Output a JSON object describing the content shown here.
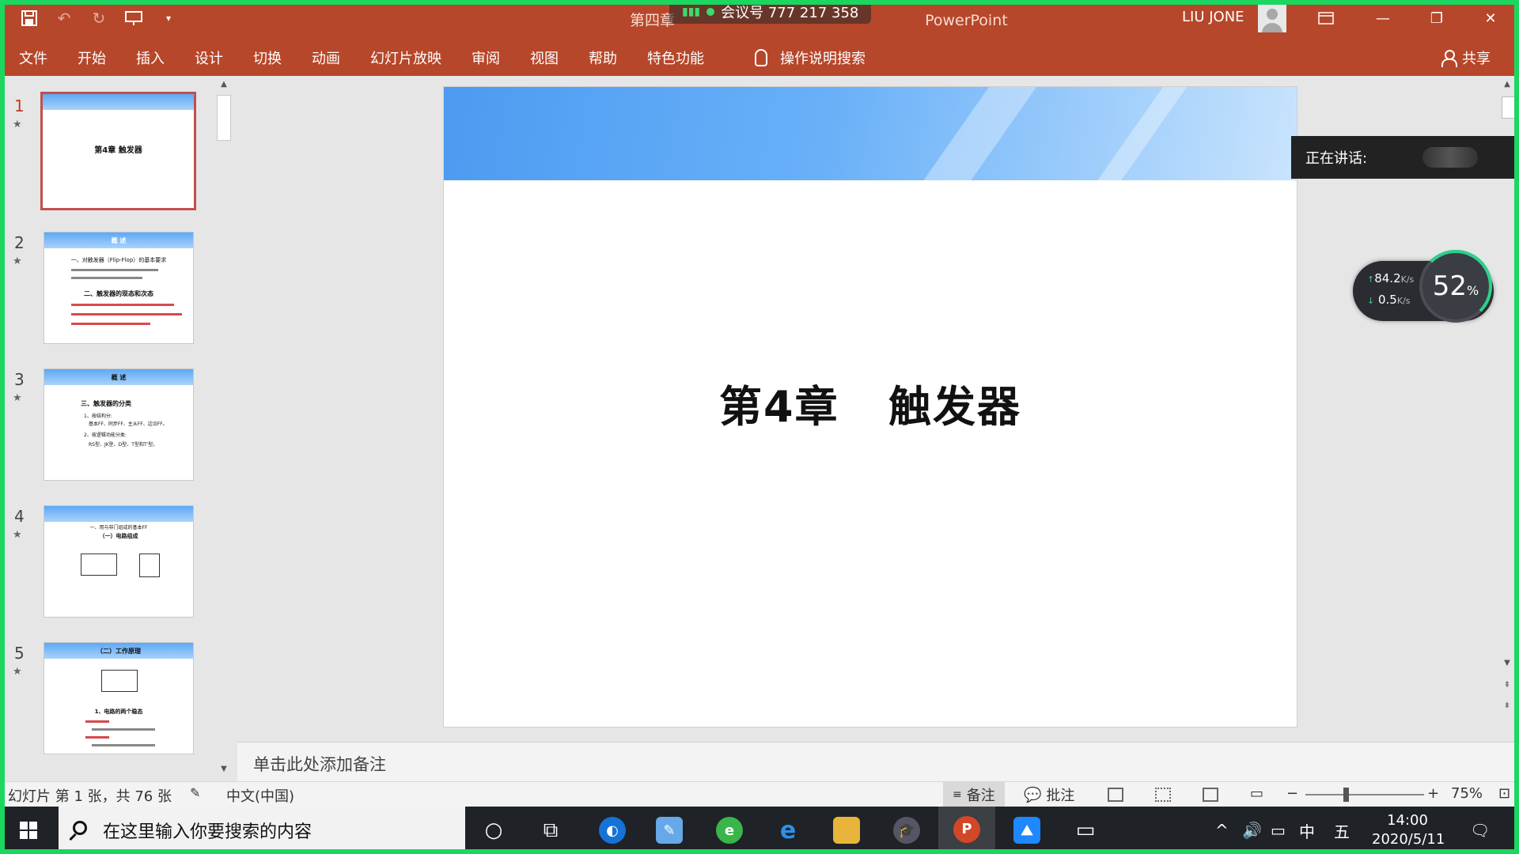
{
  "titlebar": {
    "doc_title": "第四章",
    "app_name": "PowerPoint",
    "meeting_label": "会议号 777 217 358",
    "user_name": "LIU JONE",
    "colors": {
      "ribbon": "#b7472a",
      "share_border": "#1bd760"
    }
  },
  "ribbon": {
    "tabs": [
      "文件",
      "开始",
      "插入",
      "设计",
      "切换",
      "动画",
      "幻灯片放映",
      "审阅",
      "视图",
      "帮助",
      "特色功能"
    ],
    "tell_me": "操作说明搜索",
    "share": "共享"
  },
  "thumbnails": [
    {
      "num": "1",
      "title": "第4章  触发器",
      "selected": true
    },
    {
      "num": "2",
      "title": "概  述"
    },
    {
      "num": "3",
      "title": "概  述"
    },
    {
      "num": "4",
      "title": ""
    },
    {
      "num": "5",
      "title": "（二）工作原理"
    }
  ],
  "thumb_texts": {
    "t2_l1": "一、对触发器（Flip-Flop）的基本要求",
    "t2_l2": "二、触发器的现态和次态",
    "t3_l1": "三、触发器的分类",
    "t3_l2": "1、按结构分:",
    "t3_l3": "基本FF、同步FF、主从FF、边沿FF。",
    "t3_l4": "2、按逻辑功能分类:",
    "t3_l5": "RS型、JK型、D型、T型和T'型。",
    "t4_l1": "一、用与非门组成的基本FF",
    "t4_l2": "（一）电路组成",
    "t5_l1": "1、电路的两个稳态"
  },
  "slide": {
    "title_a": "第4章",
    "title_b": "触发器"
  },
  "speaking": {
    "label": "正在讲话:"
  },
  "network": {
    "upload": "84.2",
    "download": "0.5",
    "unit": "K/s",
    "cpu_value": "52",
    "cpu_unit": "%"
  },
  "notes": {
    "placeholder": "单击此处添加备注"
  },
  "status": {
    "slide_info": "幻灯片 第 1 张，共 76 张",
    "language": "中文(中国)",
    "notes_btn": "备注",
    "comments_btn": "批注",
    "zoom": "75%"
  },
  "taskbar": {
    "search_placeholder": "在这里输入你要搜索的内容",
    "ime": "中",
    "ime2": "五",
    "time": "14:00",
    "date": "2020/5/11"
  }
}
